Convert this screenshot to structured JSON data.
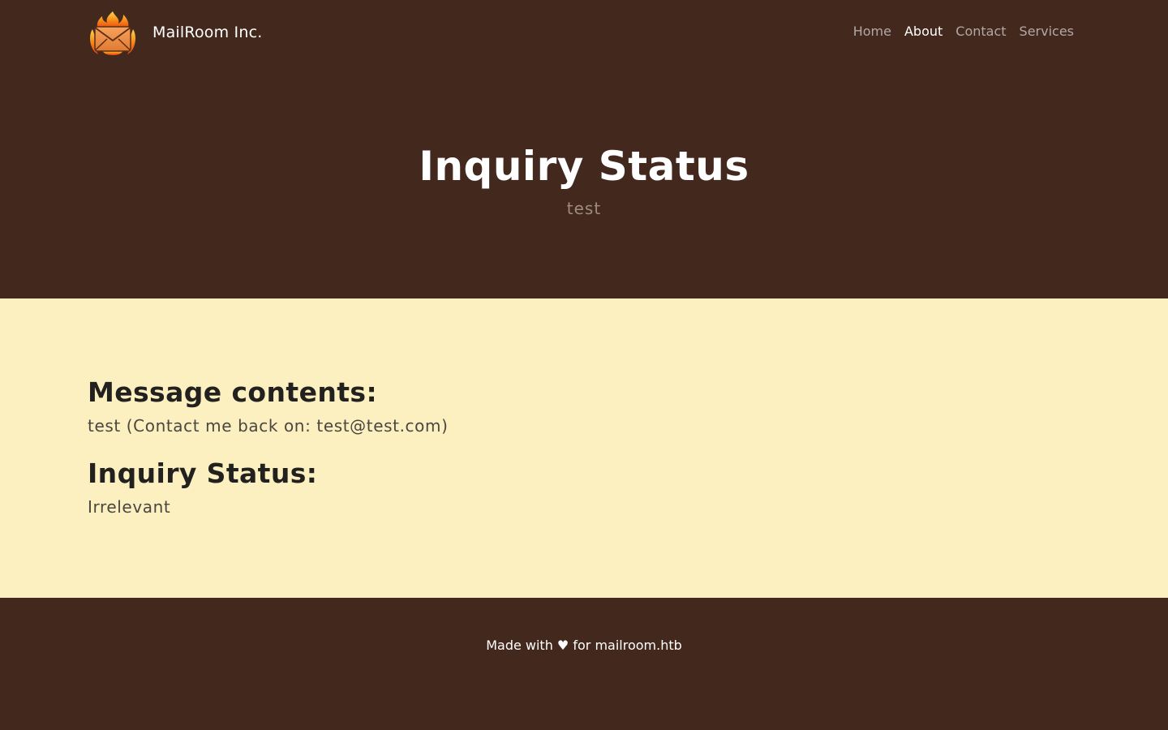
{
  "brand": {
    "name": "MailRoom Inc.",
    "logo_icon": "flaming-envelope-logo"
  },
  "nav": {
    "items": [
      {
        "label": "Home",
        "active": false
      },
      {
        "label": "About",
        "active": true
      },
      {
        "label": "Contact",
        "active": false
      },
      {
        "label": "Services",
        "active": false
      }
    ]
  },
  "hero": {
    "title": "Inquiry Status",
    "subtitle": "test"
  },
  "main": {
    "message_heading": "Message contents:",
    "message_text": "test (Contact me back on: test@test.com)",
    "status_heading": "Inquiry Status:",
    "status_text": "Irrelevant"
  },
  "footer": {
    "text": "Made with ♥ for mailroom.htb"
  },
  "colors": {
    "header_background": "#43281e",
    "content_background": "#fcf0c0",
    "nav_inactive": "#b3a8a4",
    "nav_active": "#ffffff"
  }
}
